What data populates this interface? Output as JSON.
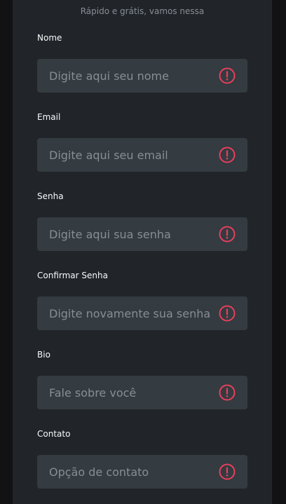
{
  "header": {
    "subtitle": "Rápido e grátis, vamos nessa"
  },
  "colors": {
    "page_background": "#121214",
    "card_background": "#212529",
    "input_background": "#343b41",
    "label_text": "#f8f9fa",
    "placeholder_text": "#868e96",
    "error_accent": "#e83f5b"
  },
  "form": {
    "fields": [
      {
        "label": "Nome",
        "placeholder": "Digite aqui seu nome",
        "value": "",
        "icon": "error-alert-icon"
      },
      {
        "label": "Email",
        "placeholder": "Digite aqui seu email",
        "value": "",
        "icon": "error-alert-icon"
      },
      {
        "label": "Senha",
        "placeholder": "Digite aqui sua senha",
        "value": "",
        "icon": "error-alert-icon"
      },
      {
        "label": "Confirmar Senha",
        "placeholder": "Digite novamente sua senha",
        "value": "",
        "icon": "error-alert-icon"
      },
      {
        "label": "Bio",
        "placeholder": "Fale sobre você",
        "value": "",
        "icon": "error-alert-icon"
      },
      {
        "label": "Contato",
        "placeholder": "Opção de contato",
        "value": "",
        "icon": "error-alert-icon"
      }
    ]
  }
}
